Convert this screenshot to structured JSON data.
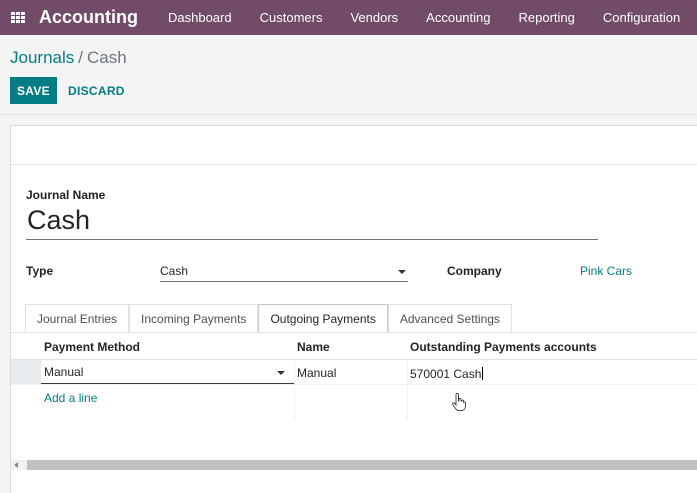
{
  "navbar": {
    "app_title": "Accounting",
    "menu": [
      "Dashboard",
      "Customers",
      "Vendors",
      "Accounting",
      "Reporting",
      "Configuration"
    ]
  },
  "breadcrumb": {
    "parent": "Journals",
    "separator": "/",
    "current": "Cash"
  },
  "buttons": {
    "save": "SAVE",
    "discard": "DISCARD"
  },
  "form": {
    "journal_name_label": "Journal Name",
    "journal_name": "Cash",
    "type_label": "Type",
    "type_value": "Cash",
    "company_label": "Company",
    "company_value": "Pink Cars"
  },
  "tabs": [
    {
      "label": "Journal Entries",
      "active": false
    },
    {
      "label": "Incoming Payments",
      "active": false
    },
    {
      "label": "Outgoing Payments",
      "active": true
    },
    {
      "label": "Advanced Settings",
      "active": false
    }
  ],
  "table": {
    "columns": [
      "Payment Method",
      "Name",
      "Outstanding Payments accounts"
    ],
    "rows": [
      {
        "method": "Manual",
        "name": "Manual",
        "account": "570001 Cash"
      }
    ],
    "add_line": "Add a line"
  },
  "icons": {
    "apps": "apps-grid-icon",
    "dropdown": "caret-down-icon",
    "pointer": "hand-pointer-icon",
    "scroll_left": "scroll-left-arrow-icon"
  },
  "colors": {
    "navbar": "#714b67",
    "primary": "#017e84"
  }
}
